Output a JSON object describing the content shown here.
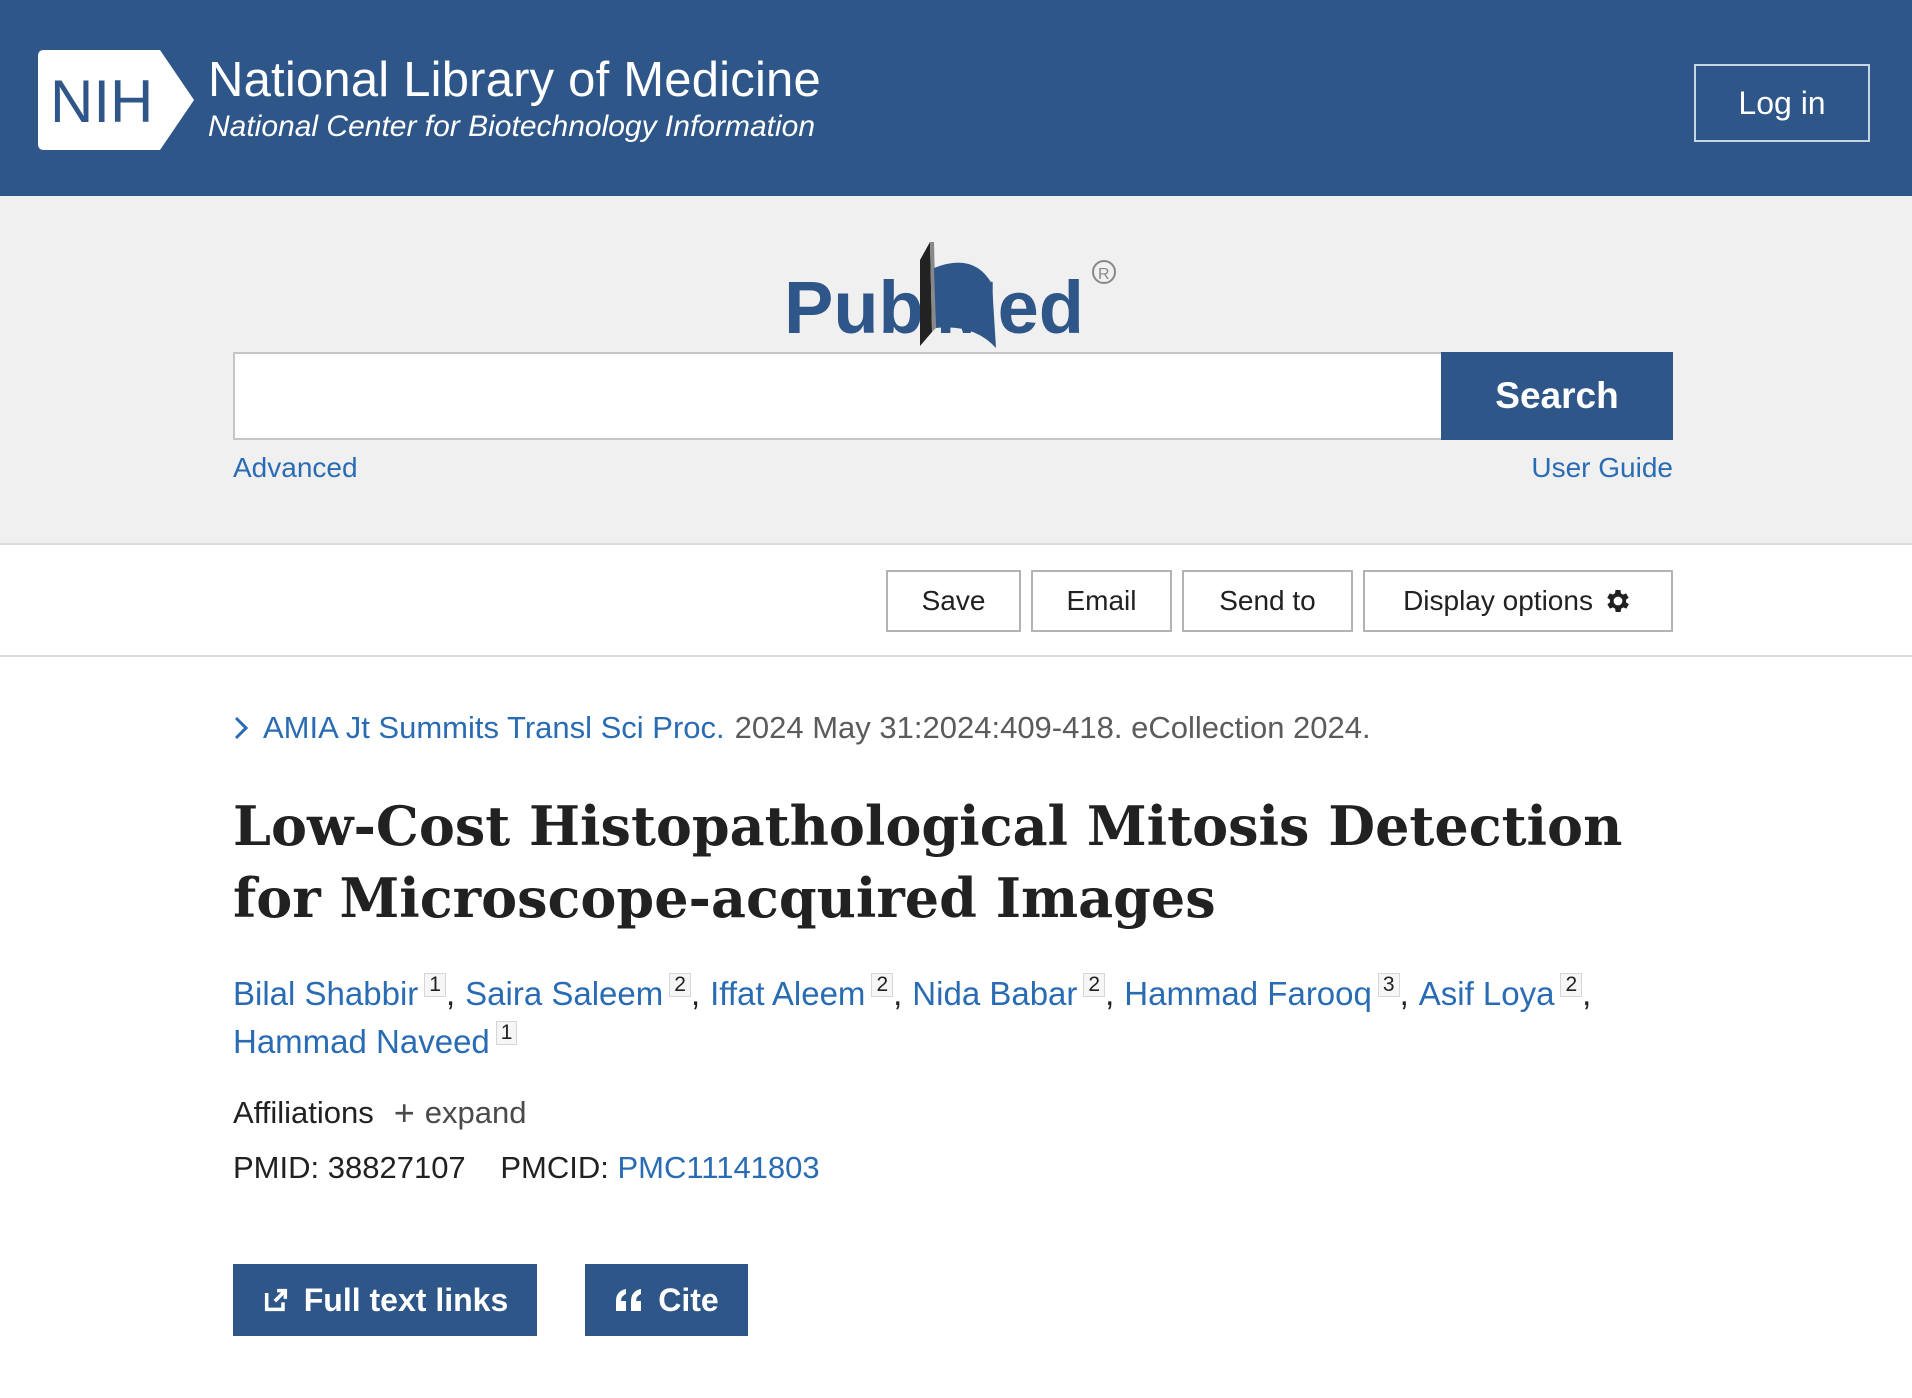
{
  "header": {
    "logo_text": "NIH",
    "title": "National Library of Medicine",
    "subtitle": "National Center for Biotechnology Information",
    "login_label": "Log in"
  },
  "search": {
    "logo_text": "PubMed",
    "input_value": "",
    "placeholder": "",
    "button_label": "Search",
    "advanced_label": "Advanced",
    "user_guide_label": "User Guide"
  },
  "actions": {
    "save": "Save",
    "email": "Email",
    "send_to": "Send to",
    "display_options": "Display options"
  },
  "article": {
    "journal": "AMIA Jt Summits Transl Sci Proc.",
    "citation_details": "2024 May 31:2024:409-418. eCollection 2024.",
    "title": "Low-Cost Histopathological Mitosis Detection for Microscope-acquired Images",
    "authors": [
      {
        "name": "Bilal Shabbir",
        "aff": "1"
      },
      {
        "name": "Saira Saleem",
        "aff": "2"
      },
      {
        "name": "Iffat Aleem",
        "aff": "2"
      },
      {
        "name": "Nida Babar",
        "aff": "2"
      },
      {
        "name": "Hammad Farooq",
        "aff": "3"
      },
      {
        "name": "Asif Loya",
        "aff": "2"
      },
      {
        "name": "Hammad Naveed",
        "aff": "1"
      }
    ],
    "affiliations_label": "Affiliations",
    "expand_label": "expand",
    "pmid_label": "PMID:",
    "pmid": "38827107",
    "pmcid_label": "PMCID:",
    "pmcid": "PMC11141803"
  },
  "buttons": {
    "full_text_links": "Full text links",
    "cite": "Cite"
  },
  "colors": {
    "header_blue": "#2f5689",
    "link_blue": "#2a6cb3",
    "search_band_gray": "#f0f0f0"
  }
}
